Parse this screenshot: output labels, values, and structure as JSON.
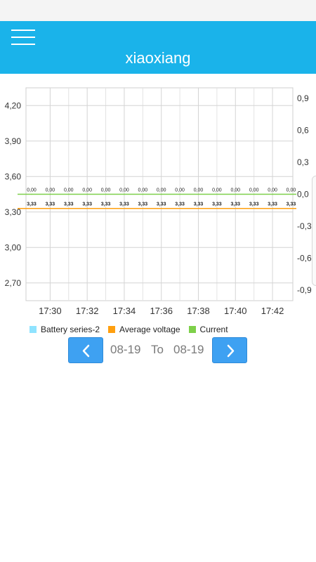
{
  "app": {
    "title": "xiaoxiang"
  },
  "icons": {
    "menu": "hamburger-menu-icon",
    "prev": "chevron-left-icon",
    "next": "chevron-right-icon"
  },
  "colors": {
    "appbar": "#1ab3ea",
    "nav_button": "#3ea1f2",
    "battery_series": "#8fe3ff",
    "average_voltage": "#ff9f0f",
    "current": "#7ed04a"
  },
  "legend": [
    {
      "label": "Battery series-2",
      "color": "#8fe3ff"
    },
    {
      "label": "Average voltage",
      "color": "#ff9f0f"
    },
    {
      "label": "Current",
      "color": "#7ed04a"
    }
  ],
  "date_range": {
    "start": "08-19",
    "separator": "To",
    "end": "08-19"
  },
  "chart_data": {
    "type": "line",
    "x_ticks": [
      "17:30",
      "17:32",
      "17:34",
      "17:36",
      "17:38",
      "17:40",
      "17:42"
    ],
    "x_points": [
      "17:29",
      "17:30",
      "17:31",
      "17:32",
      "17:33",
      "17:34",
      "17:35",
      "17:36",
      "17:37",
      "17:38",
      "17:39",
      "17:40",
      "17:41",
      "17:42",
      "17:43"
    ],
    "left_axis": {
      "ticks": [
        "4,20",
        "3,90",
        "3,60",
        "3,30",
        "3,00",
        "2,70"
      ],
      "tick_values": [
        4.2,
        3.9,
        3.6,
        3.3,
        3.0,
        2.7
      ],
      "ylim": [
        2.55,
        4.35
      ]
    },
    "right_axis": {
      "ticks": [
        "0,9",
        "0,6",
        "0,3",
        "0,0",
        "-0,3",
        "-0,6",
        "-0,9"
      ],
      "tick_values": [
        0.9,
        0.6,
        0.3,
        0.0,
        -0.3,
        -0.6,
        -0.9
      ],
      "ylim": [
        -1.0,
        1.0
      ]
    },
    "grid": true,
    "legend_position": "bottom-left",
    "series": [
      {
        "name": "Battery series-2",
        "axis": "left",
        "color": "#8fe3ff",
        "values": [
          3.33,
          3.33,
          3.33,
          3.33,
          3.33,
          3.33,
          3.33,
          3.33,
          3.33,
          3.33,
          3.33,
          3.33,
          3.33,
          3.33,
          3.33
        ]
      },
      {
        "name": "Average voltage",
        "axis": "left",
        "color": "#ff9f0f",
        "values": [
          3.33,
          3.33,
          3.33,
          3.33,
          3.33,
          3.33,
          3.33,
          3.33,
          3.33,
          3.33,
          3.33,
          3.33,
          3.33,
          3.33,
          3.33
        ],
        "labels": [
          "3,33",
          "3,33",
          "3,33",
          "3,33",
          "3,33",
          "3,33",
          "3,33",
          "3,33",
          "3,33",
          "3,33",
          "3,33",
          "3,33",
          "3,33",
          "3,33",
          "3,33"
        ]
      },
      {
        "name": "Current",
        "axis": "right",
        "color": "#7ed04a",
        "values": [
          0,
          0,
          0,
          0,
          0,
          0,
          0,
          0,
          0,
          0,
          0,
          0,
          0,
          0,
          0
        ],
        "labels": [
          "0,00",
          "0,00",
          "0,00",
          "0,00",
          "0,00",
          "0,00",
          "0,00",
          "0,00",
          "0,00",
          "0,00",
          "0,00",
          "0,00",
          "0,00",
          "0,00",
          "0,00"
        ]
      }
    ]
  }
}
